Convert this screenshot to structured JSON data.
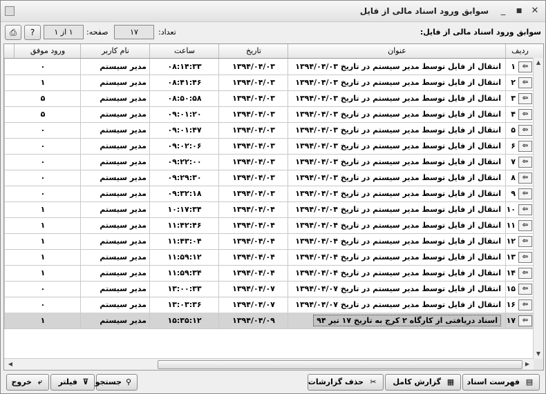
{
  "window": {
    "title": "سوابق ورود اسناد مالی از فایل",
    "buttons": {
      "minimize": "_",
      "restore": "■",
      "close": "✕"
    }
  },
  "info": {
    "heading": "سوابق ورود اسناد مالی از فایل:",
    "count_label": "تعداد:",
    "count_value": "۱۷",
    "page_label": "صفحه:",
    "page_value": "۱ از ۱"
  },
  "grid": {
    "columns": [
      "ردیف",
      "عنوان",
      "تاریخ",
      "ساعت",
      "نام کاربر",
      "ورود موفق"
    ],
    "rows": [
      {
        "num": "۱",
        "title": "انتقال از فایل توسط مدیر سیستم در تاریخ ۱۳۹۴/۰۴/۰۳",
        "date": "۱۳۹۴/۰۴/۰۳",
        "time": "۰۸:۱۴:۳۳",
        "user": "مدیر سیستم",
        "ok": "۰"
      },
      {
        "num": "۲",
        "title": "انتقال از فایل توسط مدیر سیستم در تاریخ ۱۳۹۴/۰۴/۰۳",
        "date": "۱۳۹۴/۰۴/۰۳",
        "time": "۰۸:۴۱:۴۶",
        "user": "مدیر سیستم",
        "ok": "۱"
      },
      {
        "num": "۳",
        "title": "انتقال از فایل توسط مدیر سیستم در تاریخ ۱۳۹۴/۰۴/۰۳",
        "date": "۱۳۹۴/۰۴/۰۳",
        "time": "۰۸:۵۰:۵۸",
        "user": "مدیر سیستم",
        "ok": "۵"
      },
      {
        "num": "۴",
        "title": "انتقال از فایل توسط مدیر سیستم در تاریخ ۱۳۹۴/۰۴/۰۳",
        "date": "۱۳۹۴/۰۴/۰۳",
        "time": "۰۹:۰۱:۲۰",
        "user": "مدیر سیستم",
        "ok": "۵"
      },
      {
        "num": "۵",
        "title": "انتقال از فایل توسط مدیر سیستم در تاریخ ۱۳۹۴/۰۴/۰۳",
        "date": "۱۳۹۴/۰۴/۰۳",
        "time": "۰۹:۰۱:۴۷",
        "user": "مدیر سیستم",
        "ok": "۰"
      },
      {
        "num": "۶",
        "title": "انتقال از فایل توسط مدیر سیستم در تاریخ ۱۳۹۴/۰۴/۰۳",
        "date": "۱۳۹۴/۰۴/۰۳",
        "time": "۰۹:۰۲:۰۶",
        "user": "مدیر سیستم",
        "ok": "۰"
      },
      {
        "num": "۷",
        "title": "انتقال از فایل توسط مدیر سیستم در تاریخ ۱۳۹۴/۰۴/۰۳",
        "date": "۱۳۹۴/۰۴/۰۳",
        "time": "۰۹:۲۲:۰۰",
        "user": "مدیر سیستم",
        "ok": "۰"
      },
      {
        "num": "۸",
        "title": "انتقال از فایل توسط مدیر سیستم در تاریخ ۱۳۹۴/۰۴/۰۳",
        "date": "۱۳۹۴/۰۴/۰۳",
        "time": "۰۹:۲۹:۳۰",
        "user": "مدیر سیستم",
        "ok": "۰"
      },
      {
        "num": "۹",
        "title": "انتقال از فایل توسط مدیر سیستم در تاریخ ۱۳۹۴/۰۴/۰۳",
        "date": "۱۳۹۴/۰۴/۰۳",
        "time": "۰۹:۳۲:۱۸",
        "user": "مدیر سیستم",
        "ok": "۰"
      },
      {
        "num": "۱۰",
        "title": "انتقال از فایل توسط مدیر سیستم در تاریخ ۱۳۹۴/۰۴/۰۴",
        "date": "۱۳۹۴/۰۴/۰۴",
        "time": "۱۰:۱۷:۳۴",
        "user": "مدیر سیستم",
        "ok": "۱"
      },
      {
        "num": "۱۱",
        "title": "انتقال از فایل توسط مدیر سیستم در تاریخ ۱۳۹۴/۰۴/۰۴",
        "date": "۱۳۹۴/۰۴/۰۴",
        "time": "۱۱:۴۲:۴۶",
        "user": "مدیر سیستم",
        "ok": "۱"
      },
      {
        "num": "۱۲",
        "title": "انتقال از فایل توسط مدیر سیستم در تاریخ ۱۳۹۴/۰۴/۰۴",
        "date": "۱۳۹۴/۰۴/۰۴",
        "time": "۱۱:۴۳:۰۴",
        "user": "مدیر سیستم",
        "ok": "۱"
      },
      {
        "num": "۱۳",
        "title": "انتقال از فایل توسط مدیر سیستم در تاریخ ۱۳۹۴/۰۴/۰۴",
        "date": "۱۳۹۴/۰۴/۰۴",
        "time": "۱۱:۵۹:۱۲",
        "user": "مدیر سیستم",
        "ok": "۱"
      },
      {
        "num": "۱۴",
        "title": "انتقال از فایل توسط مدیر سیستم در تاریخ ۱۳۹۴/۰۴/۰۴",
        "date": "۱۳۹۴/۰۴/۰۴",
        "time": "۱۱:۵۹:۳۴",
        "user": "مدیر سیستم",
        "ok": "۱"
      },
      {
        "num": "۱۵",
        "title": "انتقال از فایل توسط مدیر سیستم در تاریخ ۱۳۹۴/۰۴/۰۷",
        "date": "۱۳۹۴/۰۴/۰۷",
        "time": "۱۳:۰۰:۳۳",
        "user": "مدیر سیستم",
        "ok": "۰"
      },
      {
        "num": "۱۶",
        "title": "انتقال از فایل توسط مدیر سیستم در تاریخ ۱۳۹۴/۰۴/۰۷",
        "date": "۱۳۹۴/۰۴/۰۷",
        "time": "۱۳:۰۳:۳۶",
        "user": "مدیر سیستم",
        "ok": "۰"
      },
      {
        "num": "۱۷",
        "title": "اسناد دریافتی از کارگاه ۲ کرج به تاریخ ۱۷ تیر ۹۴",
        "date": "۱۳۹۴/۰۴/۰۹",
        "time": "۱۵:۳۵:۱۲",
        "user": "مدیر سیستم",
        "ok": "۱"
      }
    ]
  },
  "footer": {
    "list_docs": "فهرست اسناد",
    "full_report": "گزارش کامل",
    "delete_reports": "حذف گزارشات",
    "search": "جستجو",
    "filter": "فیلتر",
    "exit": "خروج"
  },
  "icons": {
    "row_arrow": "arrow-left-icon",
    "print": "printer-icon",
    "help": "help-icon"
  }
}
